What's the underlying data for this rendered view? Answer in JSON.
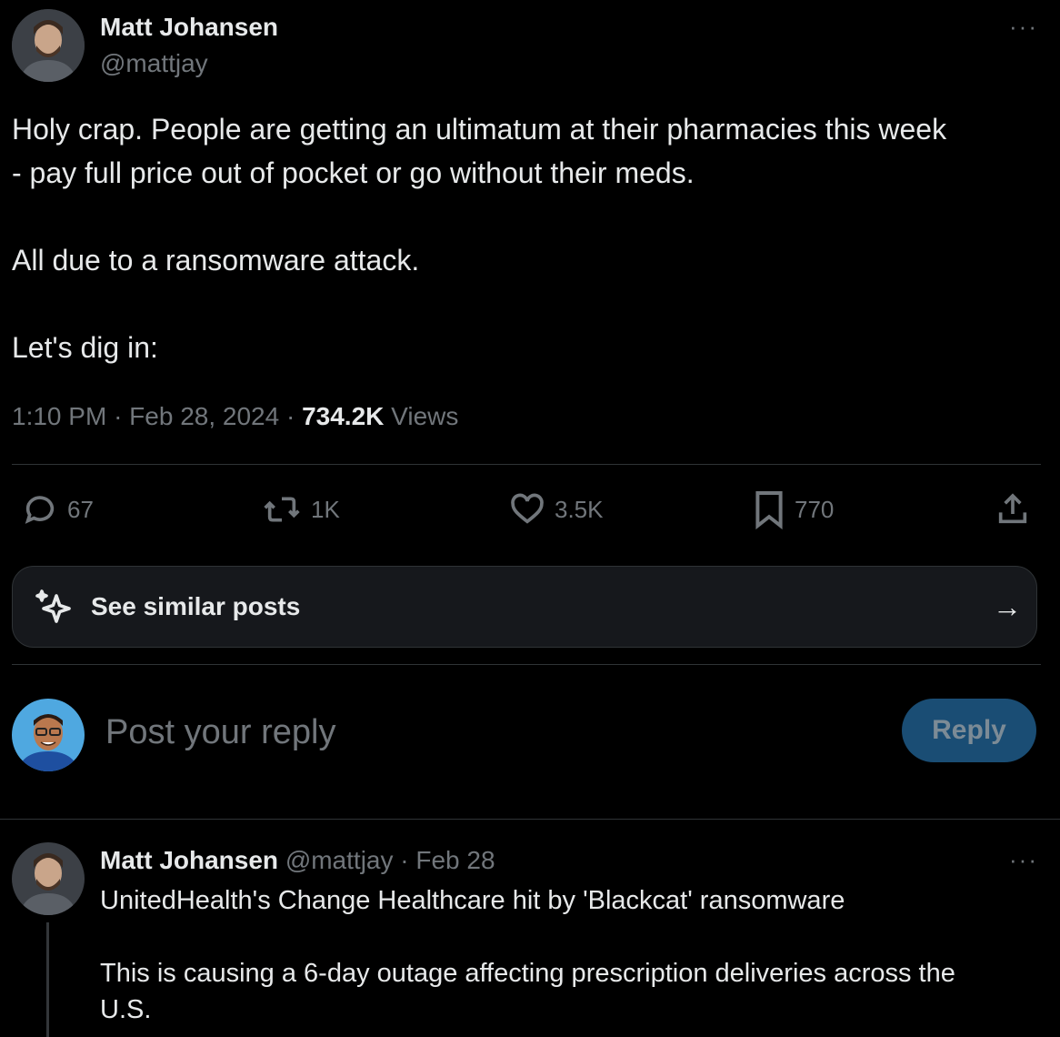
{
  "tweet": {
    "author_name": "Matt Johansen",
    "author_handle": "@mattjay",
    "more_label": "···",
    "text": "Holy crap. People are getting an ultimatum at their pharmacies this week\n- pay full price out of pocket or go without their meds.\n\nAll due to a ransomware attack.\n\nLet's dig in:",
    "time": "1:10 PM",
    "date": "Feb 28, 2024",
    "sep": "·",
    "views_count": "734.2K",
    "views_label": "Views",
    "actions": {
      "replies": "67",
      "reposts": "1K",
      "likes": "3.5K",
      "bookmarks": "770"
    }
  },
  "similar": {
    "label": "See similar posts",
    "arrow": "→"
  },
  "composer": {
    "placeholder": "Post your reply",
    "button_label": "Reply"
  },
  "thread_reply": {
    "author_name": "Matt Johansen",
    "author_handle": "@mattjay",
    "date": "· Feb 28",
    "more_label": "···",
    "text": "UnitedHealth's Change Healthcare hit by 'Blackcat' ransomware\n\nThis is causing a 6-day outage affecting prescription deliveries across the\nU.S."
  },
  "colors": {
    "background": "#000000",
    "text": "#e7e9ea",
    "muted": "#71767b",
    "divider": "#2f3336",
    "reply_button": "#1a4d74"
  }
}
